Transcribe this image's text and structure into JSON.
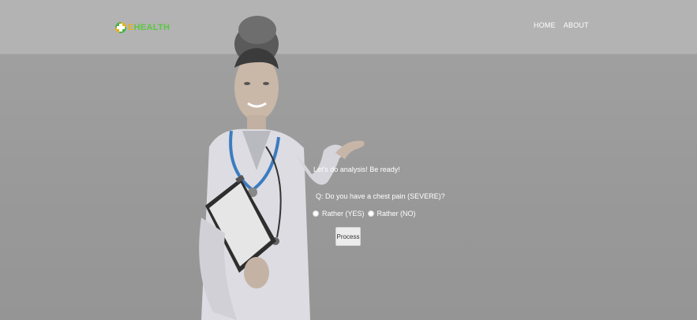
{
  "header": {
    "logo_prefix": "E",
    "logo_text": "HEALTH",
    "nav": [
      {
        "label": "HOME"
      },
      {
        "label": "ABOUT"
      }
    ]
  },
  "form": {
    "prompt": "Let's do analysis! Be ready!",
    "question": "Q: Do you have a chest pain (SEVERE)?",
    "options": [
      {
        "label": "Rather (YES)"
      },
      {
        "label": "Rather (NO)"
      }
    ],
    "process_label": "Process"
  },
  "colors": {
    "logo_green": "#5cc83f",
    "logo_yellow": "#e4b21a",
    "header_bg": "#b3b3b3",
    "page_bg": "#9a9a9a"
  }
}
